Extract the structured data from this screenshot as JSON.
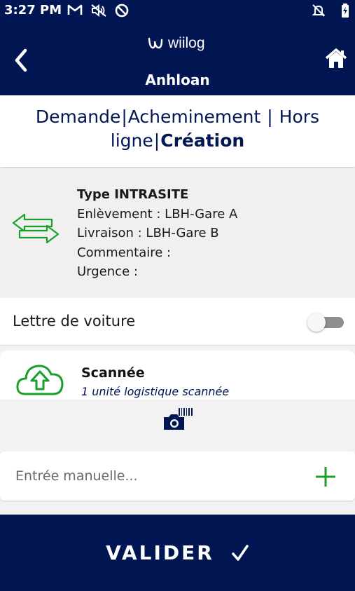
{
  "status_bar": {
    "time": "3:27 PM",
    "icons_left": [
      "gmail-icon",
      "mute-icon",
      "do-not-disturb-icon"
    ],
    "icons_right": [
      "notifications-off-icon",
      "battery-charging-icon"
    ]
  },
  "header": {
    "logo_text": "wiilog",
    "title": "Anhloan"
  },
  "breadcrumb": {
    "items": [
      "Demande",
      "Acheminement",
      "Hors ligne",
      "Création"
    ],
    "separator": "|",
    "active": "Création"
  },
  "info": {
    "type": "Type INTRASITE",
    "pickup": "Enlèvement : LBH-Gare A",
    "delivery": "Livraison : LBH-Gare B",
    "comment": "Commentaire :",
    "urgency": "Urgence :"
  },
  "waybill": {
    "label": "Lettre de voiture",
    "enabled": false
  },
  "scanned": {
    "title": "Scannée",
    "subtitle": "1 unité logistique scannée"
  },
  "manual_entry": {
    "placeholder": "Entrée manuelle...",
    "value": ""
  },
  "validate": {
    "label": "VALIDER"
  },
  "colors": {
    "navy": "#021654",
    "green": "#1aa02a",
    "background": "#f1f2f1"
  }
}
